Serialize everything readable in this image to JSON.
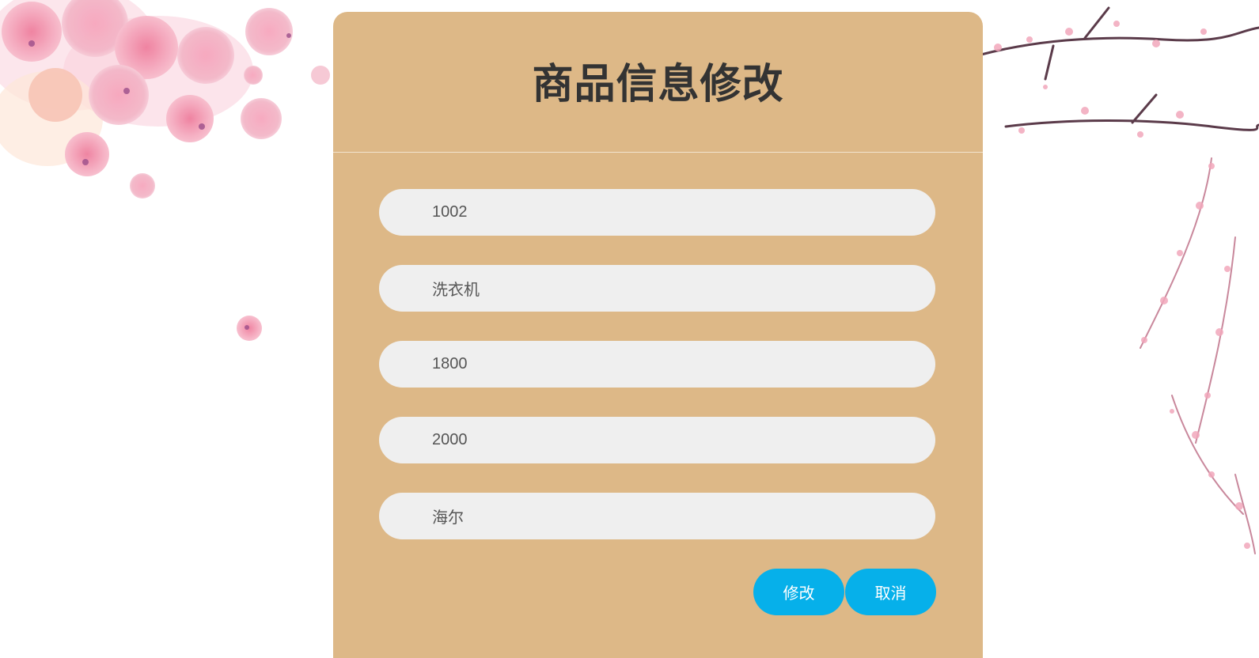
{
  "title": "商品信息修改",
  "fields": [
    {
      "value": "1002"
    },
    {
      "value": "洗衣机"
    },
    {
      "value": "1800"
    },
    {
      "value": "2000"
    },
    {
      "value": "海尔"
    }
  ],
  "buttons": {
    "modify_label": "修改",
    "cancel_label": "取消"
  },
  "colors": {
    "card_bg": "#ddb887",
    "field_bg": "#efefef",
    "button_bg": "#06b0ea",
    "title_text": "#333333",
    "field_text": "#555555"
  }
}
